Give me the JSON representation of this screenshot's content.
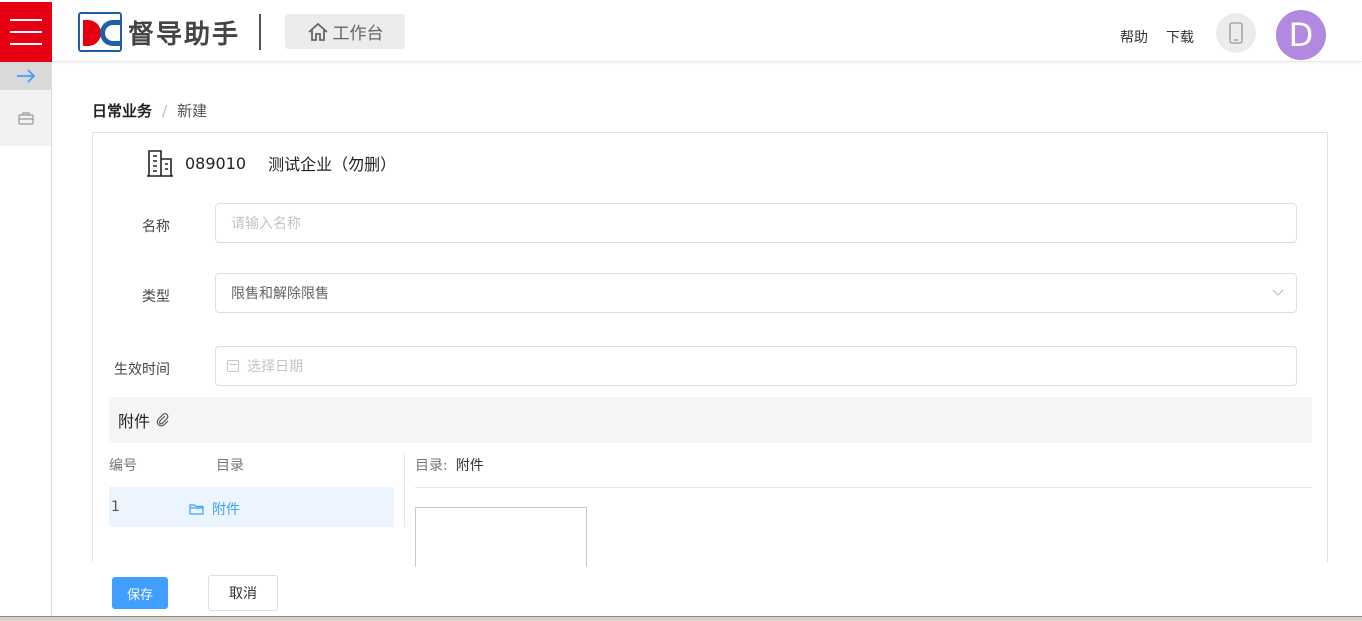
{
  "header": {
    "app_name": "督导助手",
    "workbench_label": "工作台",
    "help_label": "帮助",
    "download_label": "下载",
    "avatar_initial": "D",
    "brand_color": "#e60012",
    "avatar_color": "#b388e0"
  },
  "sidebar": {
    "items": [
      {
        "icon": "arrow-right-icon"
      },
      {
        "icon": "briefcase-icon"
      }
    ]
  },
  "breadcrumb": {
    "root": "日常业务",
    "separator": "/",
    "current": "新建"
  },
  "company": {
    "code": "089010",
    "name": "测试企业（勿删）"
  },
  "form": {
    "name_label": "名称",
    "name_placeholder": "请输入名称",
    "type_label": "类型",
    "type_value": "限售和解除限售",
    "date_label": "生效时间",
    "date_placeholder": "选择日期"
  },
  "attachments": {
    "title": "附件",
    "col_number": "编号",
    "col_directory": "目录",
    "rows": [
      {
        "number": "1",
        "directory": "附件"
      }
    ],
    "dir_label": "目录:",
    "dir_value": "附件"
  },
  "actions": {
    "save_label": "保存",
    "cancel_label": "取消",
    "primary_color": "#409eff"
  }
}
